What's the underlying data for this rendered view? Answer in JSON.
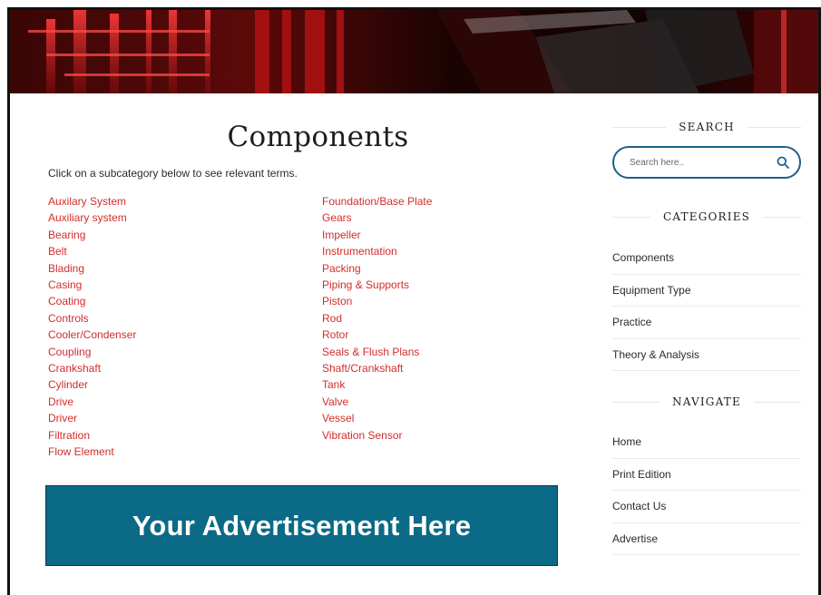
{
  "page": {
    "title": "Components",
    "intro": "Click on a subcategory below to see relevant terms."
  },
  "subcategories": {
    "left": [
      "Auxilary System",
      "Auxiliary system",
      "Bearing",
      "Belt",
      "Blading",
      "Casing",
      "Coating",
      "Controls",
      "Cooler/Condenser",
      "Coupling",
      "Crankshaft",
      "Cylinder",
      "Drive",
      "Driver",
      "Filtration",
      "Flow Element"
    ],
    "right": [
      "Foundation/Base Plate",
      "Gears",
      "Impeller",
      "Instrumentation",
      "Packing",
      "Piping & Supports",
      "Piston",
      "Rod",
      "Rotor",
      "Seals & Flush Plans",
      "Shaft/Crankshaft",
      "Tank",
      "Valve",
      "Vessel",
      "Vibration Sensor"
    ]
  },
  "advertisement": {
    "text": "Your Advertisement Here"
  },
  "sidebar": {
    "search": {
      "heading": "SEARCH",
      "placeholder": "Search here.."
    },
    "categories": {
      "heading": "CATEGORIES",
      "items": [
        "Components",
        "Equipment Type",
        "Practice",
        "Theory & Analysis"
      ]
    },
    "navigate": {
      "heading": "NAVIGATE",
      "items": [
        "Home",
        "Print Edition",
        "Contact Us",
        "Advertise"
      ]
    }
  },
  "colors": {
    "link": "#d22d2d",
    "ad_background": "#0b6a86",
    "search_border": "#1d5f8c"
  },
  "icons": {
    "search": "search-icon"
  }
}
